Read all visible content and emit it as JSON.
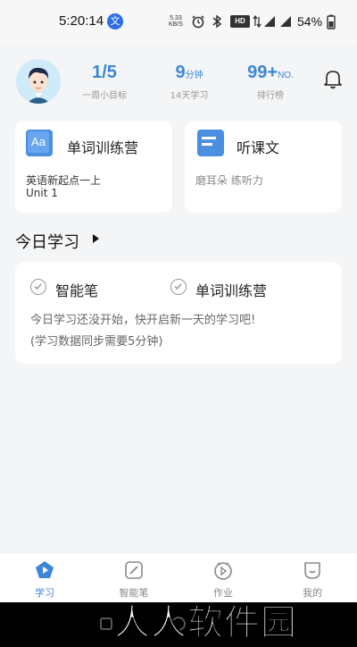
{
  "status_bar": {
    "time": "5:20:14",
    "speed_value": "5.33",
    "speed_unit": "KB/S",
    "hd_label": "HD",
    "battery": "54%"
  },
  "profile": {
    "stats": [
      {
        "value": "1/5",
        "unit": "",
        "label": "一周小目标"
      },
      {
        "value": "9",
        "unit": "分钟",
        "label": "14天学习"
      },
      {
        "value": "99+",
        "unit": "NO.",
        "label": "排行榜"
      }
    ]
  },
  "tiles": [
    {
      "icon_text": "Aa",
      "title": "单词训练营",
      "sub": "英语新起点一上",
      "sub2": "Unit 1"
    },
    {
      "title": "听课文",
      "sub": "磨耳朵 练听力"
    }
  ],
  "today": {
    "title": "今日学习",
    "items": [
      "智能笔",
      "单词训练营"
    ],
    "msg1": "今日学习还没开始，快开启新一天的学习吧!",
    "msg2": "(学习数据同步需要5分钟)"
  },
  "tabs": [
    {
      "label": "学习",
      "icon": "learn-icon",
      "active": true
    },
    {
      "label": "智能笔",
      "icon": "pen-icon",
      "active": false
    },
    {
      "label": "作业",
      "icon": "homework-icon",
      "active": false
    },
    {
      "label": "我的",
      "icon": "profile-icon",
      "active": false
    }
  ],
  "watermark": "人人软件园",
  "colors": {
    "accent": "#3c86d8",
    "background": "#f4f5f7"
  }
}
